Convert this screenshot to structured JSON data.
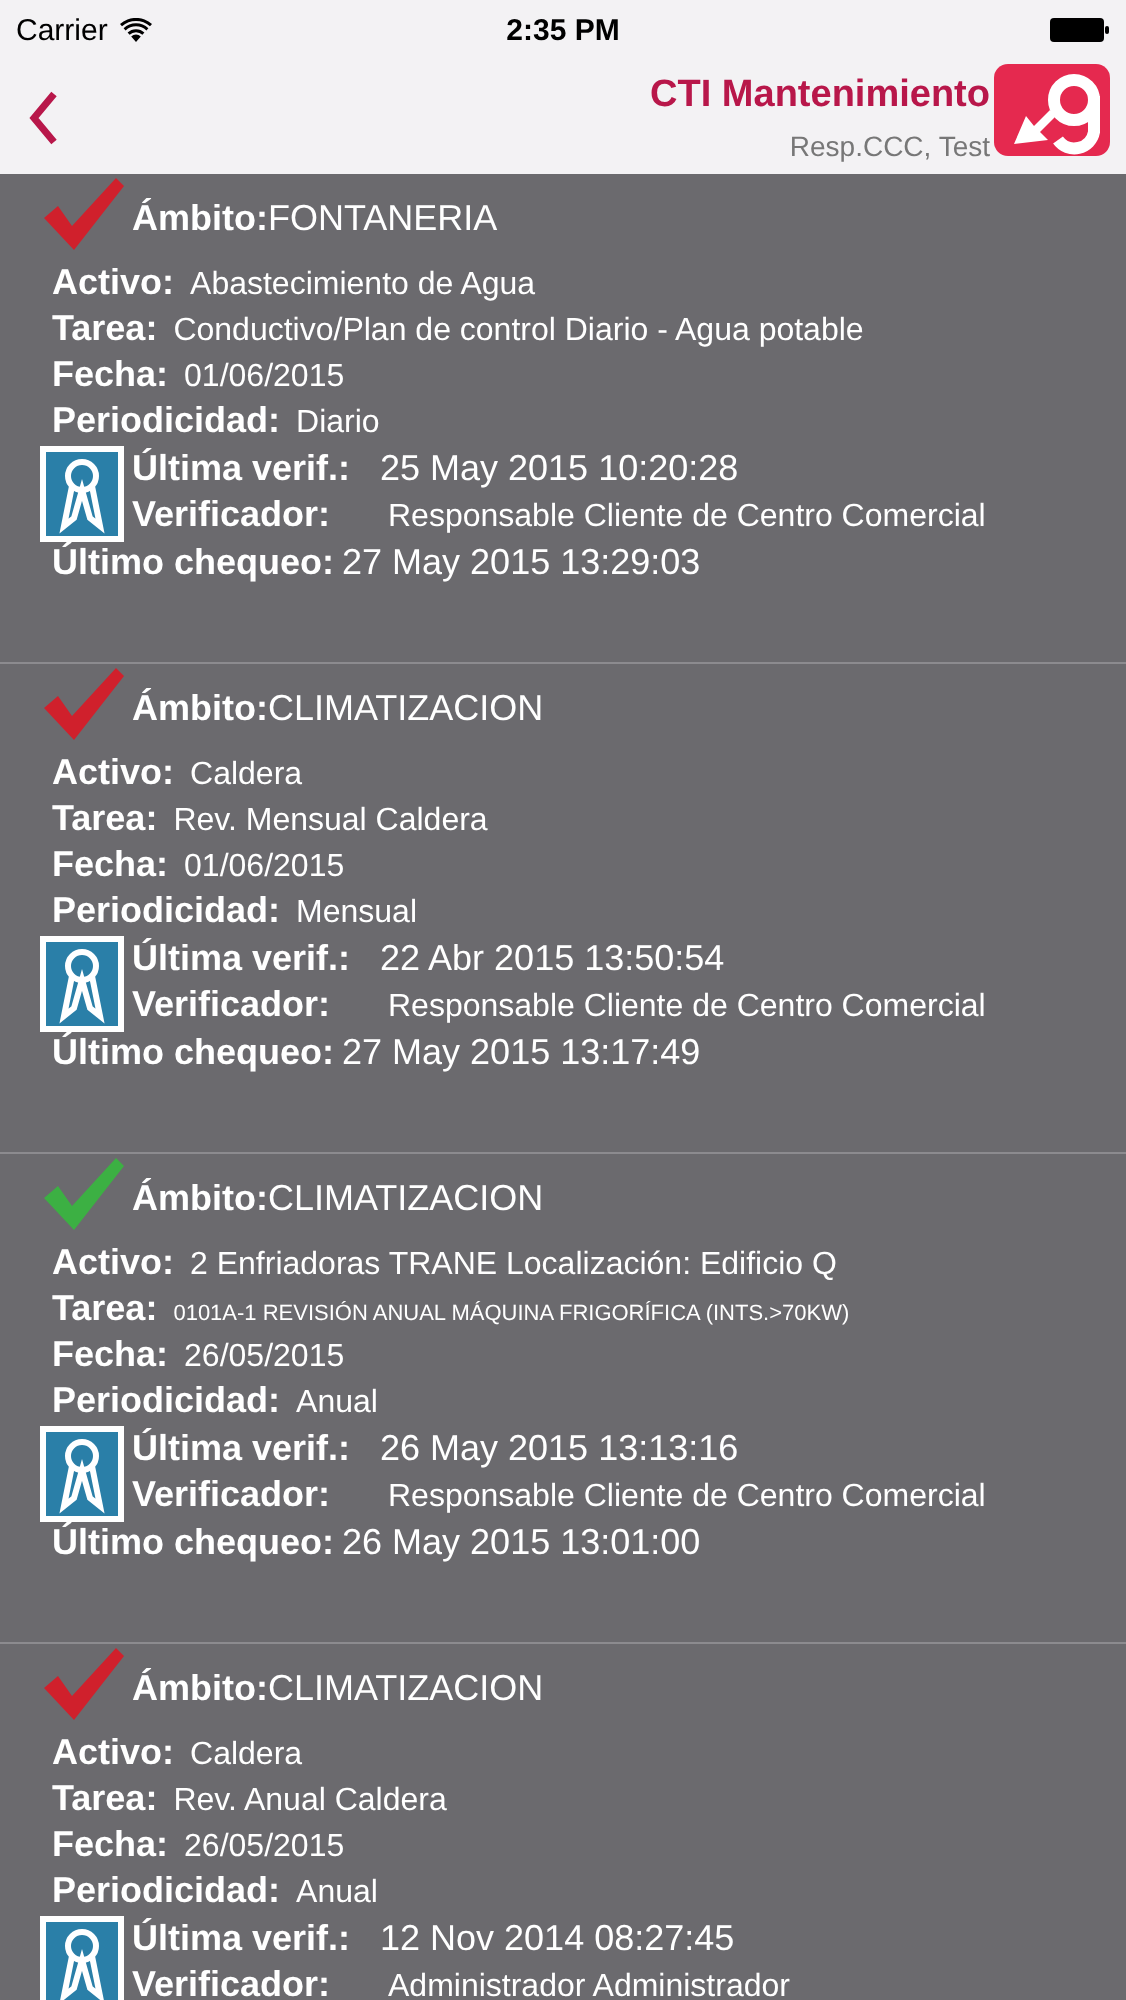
{
  "status_bar": {
    "carrier": "Carrier",
    "time": "2:35 PM"
  },
  "nav": {
    "title": "CTI Mantenimiento",
    "subtitle": "Resp.CCC, Test"
  },
  "cards": [
    {
      "color": "#d0202c",
      "scope": {
        "label": "Ámbito:",
        "value": "FONTANERIA"
      },
      "fields": [
        {
          "label": "Activo:",
          "value": "Abastecimiento de Agua",
          "small": false
        },
        {
          "label": "Tarea:",
          "value": "Conductivo/Plan de control Diario  - Agua potable",
          "small": false
        },
        {
          "label": "Fecha:",
          "value": "01/06/2015",
          "small": false
        },
        {
          "label": "Periodicidad:",
          "value": "Diario",
          "small": false
        }
      ],
      "verification": [
        {
          "label": "Última verif.:",
          "value": "25 May 2015 10:20:28"
        },
        {
          "label": "Verificador:",
          "value": "Responsable Cliente de Centro Comercial"
        }
      ],
      "last_check": {
        "label": "Último chequeo:",
        "value": "27 May 2015 13:29:03"
      }
    },
    {
      "color": "#d0202c",
      "scope": {
        "label": "Ámbito:",
        "value": "CLIMATIZACION"
      },
      "fields": [
        {
          "label": "Activo:",
          "value": "Caldera",
          "small": false
        },
        {
          "label": "Tarea:",
          "value": "Rev. Mensual Caldera",
          "small": false
        },
        {
          "label": "Fecha:",
          "value": "01/06/2015",
          "small": false
        },
        {
          "label": "Periodicidad:",
          "value": "Mensual",
          "small": false
        }
      ],
      "verification": [
        {
          "label": "Última verif.:",
          "value": "22 Abr 2015 13:50:54"
        },
        {
          "label": "Verificador:",
          "value": "Responsable Cliente de Centro Comercial"
        }
      ],
      "last_check": {
        "label": "Último chequeo:",
        "value": "27 May 2015 13:17:49"
      }
    },
    {
      "color": "#3cb043",
      "scope": {
        "label": "Ámbito:",
        "value": "CLIMATIZACION"
      },
      "fields": [
        {
          "label": "Activo:",
          "value": "2 Enfriadoras TRANE Localización: Edificio Q",
          "small": false
        },
        {
          "label": "Tarea:",
          "value": "0101A-1 REVISIÓN ANUAL MÁQUINA FRIGORÍFICA (INTS.>70KW)",
          "small": true
        },
        {
          "label": "Fecha:",
          "value": "26/05/2015",
          "small": false
        },
        {
          "label": "Periodicidad:",
          "value": "Anual",
          "small": false
        }
      ],
      "verification": [
        {
          "label": "Última verif.:",
          "value": "26 May 2015 13:13:16"
        },
        {
          "label": "Verificador:",
          "value": "Responsable Cliente de Centro Comercial"
        }
      ],
      "last_check": {
        "label": "Último chequeo:",
        "value": "26 May 2015 13:01:00"
      }
    },
    {
      "color": "#d0202c",
      "scope": {
        "label": "Ámbito:",
        "value": "CLIMATIZACION"
      },
      "fields": [
        {
          "label": "Activo:",
          "value": "Caldera",
          "small": false
        },
        {
          "label": "Tarea:",
          "value": "Rev. Anual Caldera",
          "small": false
        },
        {
          "label": "Fecha:",
          "value": "26/05/2015",
          "small": false
        },
        {
          "label": "Periodicidad:",
          "value": "Anual",
          "small": false
        }
      ],
      "verification": [
        {
          "label": "Última verif.:",
          "value": "12 Nov 2014 08:27:45"
        },
        {
          "label": "Verificador:",
          "value": "Administrador Administrador"
        }
      ]
    }
  ]
}
